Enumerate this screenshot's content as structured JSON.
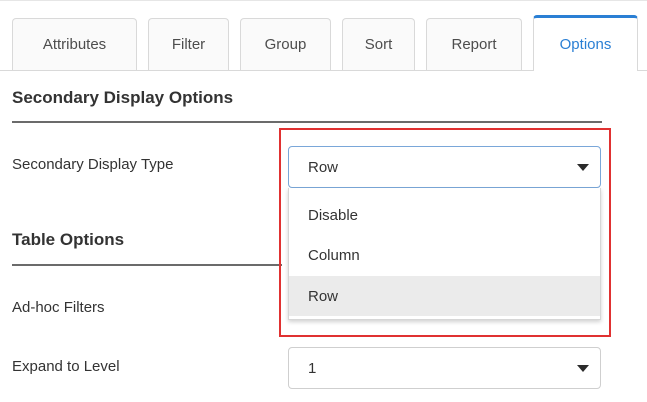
{
  "tabs": [
    {
      "label": "Attributes",
      "active": false
    },
    {
      "label": "Filter",
      "active": false
    },
    {
      "label": "Group",
      "active": false
    },
    {
      "label": "Sort",
      "active": false
    },
    {
      "label": "Report",
      "active": false
    },
    {
      "label": "Options",
      "active": true
    }
  ],
  "secondary_display": {
    "section_title": "Secondary Display Options",
    "type_label": "Secondary Display Type",
    "type_value": "Row",
    "options": [
      {
        "label": "Disable",
        "selected": false
      },
      {
        "label": "Column",
        "selected": false
      },
      {
        "label": "Row",
        "selected": true
      }
    ]
  },
  "table_options": {
    "section_title": "Table Options",
    "adhoc_label": "Ad-hoc Filters",
    "expand_label": "Expand to Level",
    "expand_value": "1"
  },
  "colors": {
    "accent": "#2a7fd4",
    "highlight": "#e03131"
  },
  "icons": [
    "caret-down-icon"
  ]
}
